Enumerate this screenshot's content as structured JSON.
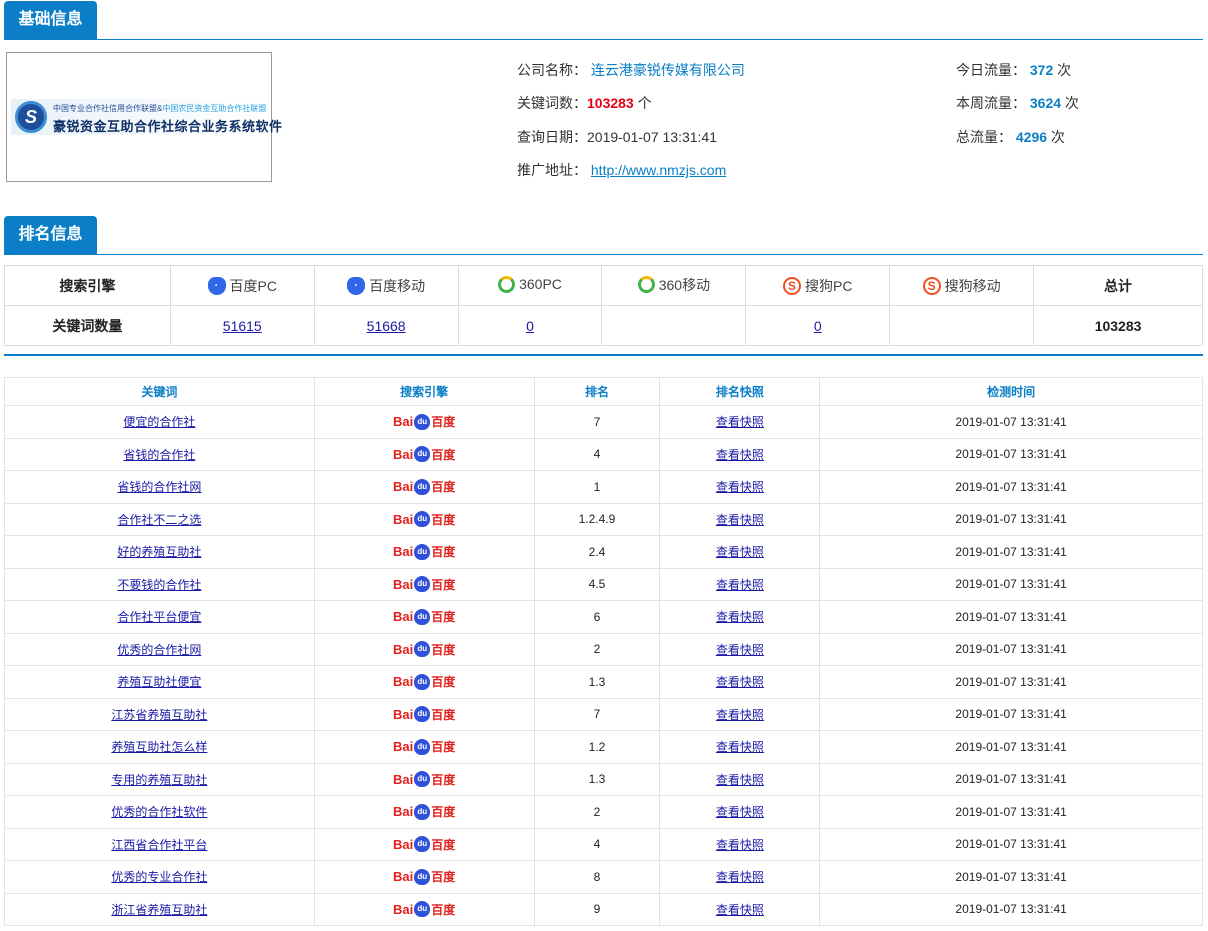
{
  "basic_section": {
    "title": "基础信息"
  },
  "logo": {
    "line1a": "中国专业合作社信用合作联盟&",
    "line1b": "中国农民资金互助合作社联盟",
    "line2": "豪锐资金互助合作社综合业务系统软件",
    "mark": "S"
  },
  "company_info": {
    "company_label": "公司名称：",
    "company_value": "连云港豪锐传媒有限公司",
    "keywords_label": "关键词数：",
    "keywords_value": "103283",
    "keywords_unit": " 个",
    "query_date_label": "查询日期：",
    "query_date_value": "2019-01-07 13:31:41",
    "url_label": "推广地址：",
    "url_value": "http://www.nmzjs.com"
  },
  "traffic": {
    "today_label": "今日流量：",
    "today_value": "372",
    "week_label": "本周流量：",
    "week_value": "3624",
    "total_label": "总流量：",
    "total_value": "4296",
    "unit": " 次"
  },
  "rank_section": {
    "title": "排名信息"
  },
  "engine_table": {
    "header_label": "搜索引擎",
    "row_label": "关键词数量",
    "total_label": "总计",
    "engines": [
      {
        "name": "百度PC",
        "icon": "baidu-icon",
        "count": "51615"
      },
      {
        "name": "百度移动",
        "icon": "baidu-icon",
        "count": "51668"
      },
      {
        "name": "360PC",
        "icon": "360-icon",
        "count": "0"
      },
      {
        "name": "360移动",
        "icon": "360-icon",
        "count": ""
      },
      {
        "name": "搜狗PC",
        "icon": "sogou-icon",
        "count": "0"
      },
      {
        "name": "搜狗移动",
        "icon": "sogou-icon",
        "count": ""
      }
    ],
    "total_value": "103283"
  },
  "rank_table": {
    "headers": [
      "关键词",
      "搜索引擎",
      "排名",
      "排名快照",
      "检测时间"
    ],
    "engine_logo": {
      "bai": "Bai",
      "paw": "du",
      "cn": "百度"
    },
    "snapshot_label": "查看快照",
    "rows": [
      {
        "keyword": "便宜的合作社",
        "rank": "7",
        "time": "2019-01-07 13:31:41"
      },
      {
        "keyword": "省钱的合作社",
        "rank": "4",
        "time": "2019-01-07 13:31:41"
      },
      {
        "keyword": "省钱的合作社网",
        "rank": "1",
        "time": "2019-01-07 13:31:41"
      },
      {
        "keyword": "合作社不二之选",
        "rank": "1.2.4.9",
        "time": "2019-01-07 13:31:41"
      },
      {
        "keyword": "好的养殖互助社",
        "rank": "2.4",
        "time": "2019-01-07 13:31:41"
      },
      {
        "keyword": "不要钱的合作社",
        "rank": "4.5",
        "time": "2019-01-07 13:31:41"
      },
      {
        "keyword": "合作社平台便宜",
        "rank": "6",
        "time": "2019-01-07 13:31:41"
      },
      {
        "keyword": "优秀的合作社网",
        "rank": "2",
        "time": "2019-01-07 13:31:41"
      },
      {
        "keyword": "养殖互助社便宜",
        "rank": "1.3",
        "time": "2019-01-07 13:31:41"
      },
      {
        "keyword": "江苏省养殖互助社",
        "rank": "7",
        "time": "2019-01-07 13:31:41"
      },
      {
        "keyword": "养殖互助社怎么样",
        "rank": "1.2",
        "time": "2019-01-07 13:31:41"
      },
      {
        "keyword": "专用的养殖互助社",
        "rank": "1.3",
        "time": "2019-01-07 13:31:41"
      },
      {
        "keyword": "优秀的合作社软件",
        "rank": "2",
        "time": "2019-01-07 13:31:41"
      },
      {
        "keyword": "江西省合作社平台",
        "rank": "4",
        "time": "2019-01-07 13:31:41"
      },
      {
        "keyword": "优秀的专业合作社",
        "rank": "8",
        "time": "2019-01-07 13:31:41"
      },
      {
        "keyword": "浙江省养殖互助社",
        "rank": "9",
        "time": "2019-01-07 13:31:41"
      }
    ]
  }
}
